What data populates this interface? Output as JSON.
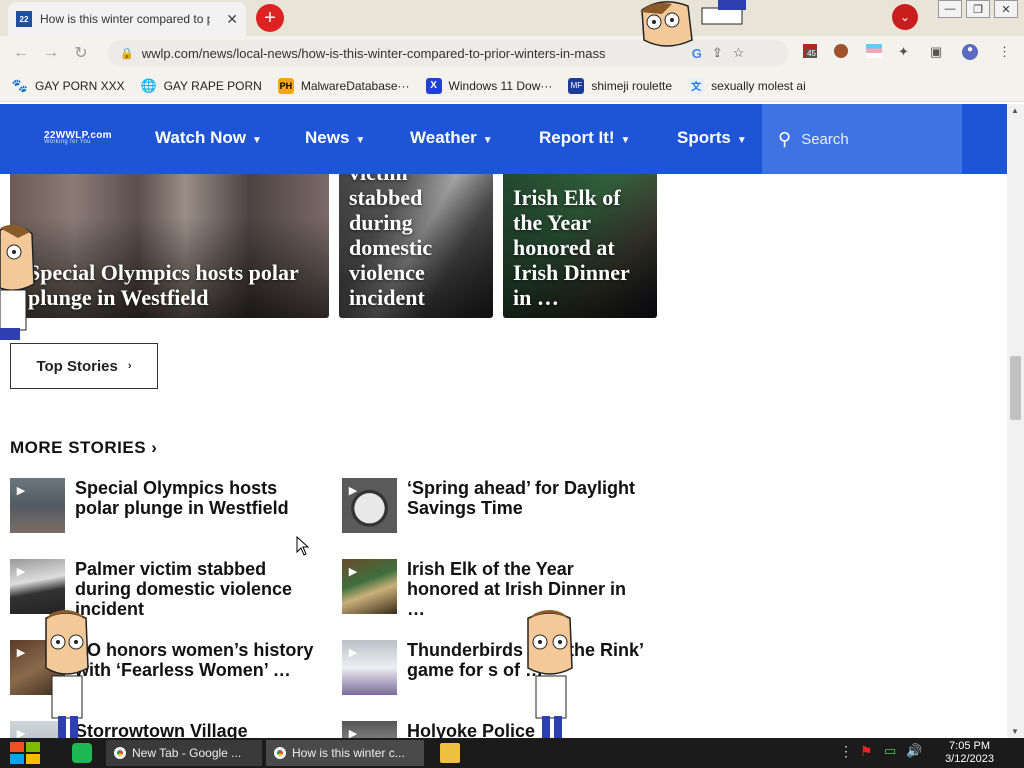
{
  "browser": {
    "tab_title": "How is this winter compared to prior winters in Mass",
    "url": "wwlp.com/news/local-news/how-is-this-winter-compared-to-prior-winters-in-mass",
    "ext_badge": "45",
    "bookmarks": [
      {
        "label": "GAY PORN XXX",
        "icon": "paw-icon"
      },
      {
        "label": "GAY RAPE PORN",
        "icon": "globe-icon"
      },
      {
        "label": "MalwareDatabase···",
        "icon": "ph-icon"
      },
      {
        "label": "Windows 11 Dow···",
        "icon": "x-icon"
      },
      {
        "label": "shimeji roulette",
        "icon": "mf-icon"
      },
      {
        "label": "sexually molest ai",
        "icon": "translate-icon"
      }
    ]
  },
  "site": {
    "logo": "22WWLP.com",
    "logo_tag": "Working for You",
    "nav": [
      "Watch Now",
      "News",
      "Weather",
      "Report It!",
      "Sports"
    ],
    "search_placeholder": "Search"
  },
  "featured": [
    {
      "caption": "Special Olympics hosts polar plunge in Westfield"
    },
    {
      "caption": "victim stabbed during domestic violence incident"
    },
    {
      "caption": "Irish Elk of the Year honored at Irish Dinner in …"
    }
  ],
  "top_stories_label": "Top Stories",
  "more_stories_label": "MORE STORIES",
  "stories": [
    {
      "title": "Special Olympics hosts polar plunge in Westfield"
    },
    {
      "title": "‘Spring ahead’ for Daylight Savings Time"
    },
    {
      "title": "Palmer victim stabbed during domestic violence incident"
    },
    {
      "title": "Irish Elk of the Year honored at Irish Dinner in …"
    },
    {
      "title": "SO honors women’s history with ‘Fearless Women’ …"
    },
    {
      "title": "Thunderbirds ‘ ’ in the Rink’ game for s of …"
    },
    {
      "title": "Storrowtown Village"
    },
    {
      "title": "Holyoke Police investigating"
    }
  ],
  "taskbar": {
    "windows": [
      "New Tab - Google ...",
      "How is this winter c..."
    ],
    "time": "7:05 PM",
    "date": "3/12/2023"
  }
}
